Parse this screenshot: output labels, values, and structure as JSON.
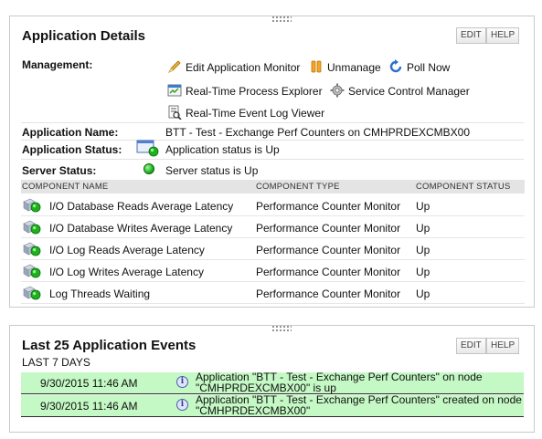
{
  "details": {
    "title": "Application Details",
    "edit_label": "EDIT",
    "help_label": "HELP",
    "management_label": "Management:",
    "management_links": {
      "edit_monitor": "Edit Application Monitor",
      "unmanage": "Unmanage",
      "poll_now": "Poll Now",
      "process_explorer": "Real-Time Process Explorer",
      "service_control": "Service Control Manager",
      "event_log_viewer": "Real-Time Event Log Viewer"
    },
    "app_name_label": "Application Name:",
    "app_name_value": "BTT - Test - Exchange Perf Counters on CMHPRDEXCMBX00",
    "app_status_label": "Application Status:",
    "app_status_value": "Application status is Up",
    "server_status_label": "Server Status:",
    "server_status_value": "Server status is Up",
    "columns": {
      "name": "COMPONENT NAME",
      "type": "COMPONENT TYPE",
      "status": "COMPONENT STATUS"
    },
    "components": [
      {
        "name": "I/O Database Reads Average Latency",
        "type": "Performance Counter Monitor",
        "status": "Up"
      },
      {
        "name": "I/O Database Writes Average Latency",
        "type": "Performance Counter Monitor",
        "status": "Up"
      },
      {
        "name": "I/O Log Reads Average Latency",
        "type": "Performance Counter Monitor",
        "status": "Up"
      },
      {
        "name": "I/O Log Writes Average Latency",
        "type": "Performance Counter Monitor",
        "status": "Up"
      },
      {
        "name": "Log Threads Waiting",
        "type": "Performance Counter Monitor",
        "status": "Up"
      }
    ],
    "status_color": "#1db11d"
  },
  "events": {
    "title": "Last 25 Application Events",
    "subtitle": "LAST 7 DAYS",
    "edit_label": "EDIT",
    "help_label": "HELP",
    "rows": [
      {
        "time": "9/30/2015 11:46 AM",
        "message": "Application \"BTT - Test - Exchange Perf Counters\" on node \"CMHPRDEXCMBX00\" is up"
      },
      {
        "time": "9/30/2015 11:46 AM",
        "message": "Application \"BTT - Test - Exchange Perf Counters\" created on node \"CMHPRDEXCMBX00\""
      }
    ],
    "row_color": "#c4f8c4"
  }
}
